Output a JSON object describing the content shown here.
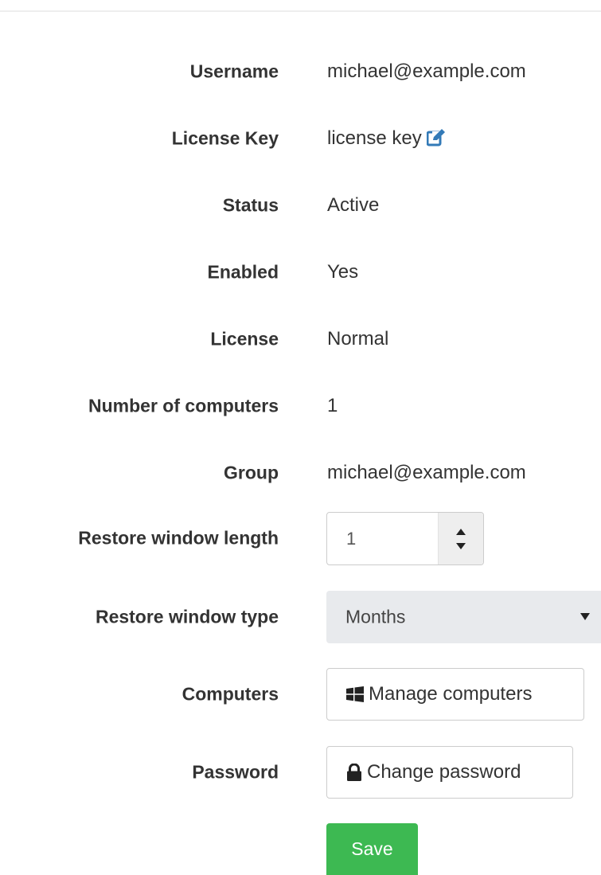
{
  "fields": {
    "username": {
      "label": "Username",
      "value": "michael@example.com"
    },
    "license_key": {
      "label": "License Key",
      "value": "license key",
      "icon": "pencil-square-icon"
    },
    "status": {
      "label": "Status",
      "value": "Active"
    },
    "enabled": {
      "label": "Enabled",
      "value": "Yes"
    },
    "license": {
      "label": "License",
      "value": "Normal"
    },
    "num_computers": {
      "label": "Number of computers",
      "value": "1"
    },
    "group": {
      "label": "Group",
      "value": "michael@example.com"
    },
    "restore_window_length": {
      "label": "Restore window length",
      "value": "1"
    },
    "restore_window_type": {
      "label": "Restore window type",
      "value": "Months"
    },
    "computers": {
      "label": "Computers",
      "button": "Manage computers",
      "icon": "windows-icon"
    },
    "password": {
      "label": "Password",
      "button": "Change password",
      "icon": "lock-icon"
    }
  },
  "actions": {
    "save": "Save"
  },
  "colors": {
    "edit_icon": "#337ab7",
    "save_button": "#3db952",
    "select_background": "#e8eaed"
  }
}
